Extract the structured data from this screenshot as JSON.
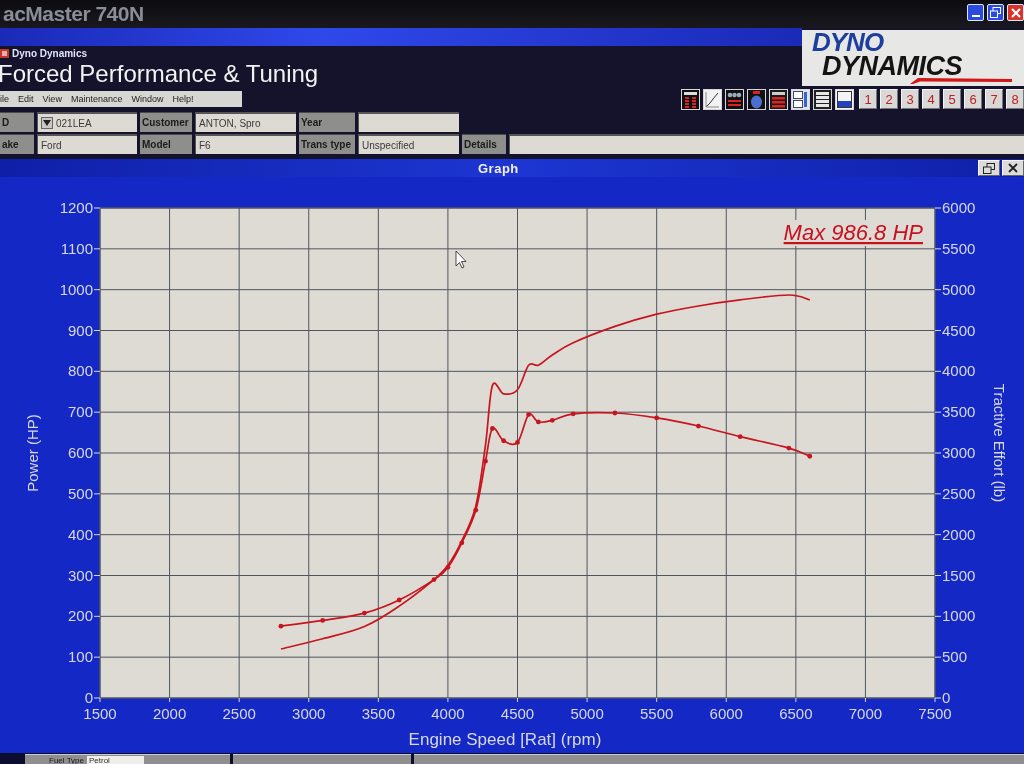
{
  "monitor": {
    "model_label": "acMaster 740N"
  },
  "window": {
    "title": "Dyno Dynamics"
  },
  "header": {
    "title": "Forced Performance & Tuning",
    "logo": {
      "line_1": "DYNO",
      "line_2": "DYNAMICS"
    }
  },
  "menu": {
    "items": [
      "ile",
      "Edit",
      "View",
      "Maintenance",
      "Window",
      "Help!"
    ]
  },
  "toolbar": {
    "run_buttons": [
      "1",
      "2",
      "3",
      "4",
      "5",
      "6",
      "7",
      "8"
    ]
  },
  "vehicle_form": {
    "rows": [
      {
        "fields": [
          {
            "kind": "dropdown",
            "label": "D",
            "value": "021LEA"
          },
          {
            "kind": "text",
            "label": "Customer",
            "value": "ANTON, Spro"
          },
          {
            "kind": "text",
            "label": "Year"
          }
        ]
      },
      {
        "fields": [
          {
            "kind": "text",
            "label": "ake",
            "value": "Ford"
          },
          {
            "kind": "text",
            "label": "Model",
            "value": "F6"
          },
          {
            "kind": "text",
            "label": "Trans type",
            "value": "Unspecified"
          },
          {
            "kind": "wide",
            "label": "Details"
          }
        ]
      }
    ]
  },
  "graph_window": {
    "title": "Graph",
    "chart_data": {
      "type": "line",
      "xlabel": "Engine Speed [Rat] (rpm)",
      "ylabel": "Power (HP)",
      "y2label": "Tractive Effort (lb)",
      "grid": true,
      "x": [
        2800,
        3100,
        3400,
        3650,
        3900,
        4000,
        4100,
        4200,
        4270,
        4320,
        4400,
        4500,
        4580,
        4650,
        4750,
        4900,
        5200,
        5500,
        5800,
        6100,
        6450,
        6600
      ],
      "series": [
        {
          "color": "#c8141e",
          "values": [
            120,
            145,
            175,
            225,
            290,
            325,
            385,
            470,
            620,
            765,
            745,
            755,
            815,
            815,
            840,
            870,
            910,
            940,
            960,
            975,
            987,
            975
          ]
        },
        {
          "axis": "y2",
          "color": "#c8141e",
          "values": [
            880,
            950,
            1040,
            1200,
            1450,
            1600,
            1900,
            2300,
            2900,
            3300,
            3150,
            3130,
            3470,
            3380,
            3400,
            3480,
            3490,
            3430,
            3330,
            3200,
            3060,
            2960
          ]
        }
      ],
      "xlim": [
        1500,
        7500
      ],
      "ylim": [
        0,
        1200
      ],
      "y2lim": [
        0,
        6000
      ],
      "xticks": [
        1500,
        2000,
        2500,
        3000,
        3500,
        4000,
        4500,
        5000,
        5500,
        6000,
        6500,
        7000,
        7500
      ],
      "yticks": [
        0,
        100,
        200,
        300,
        400,
        500,
        600,
        700,
        800,
        900,
        1000,
        1100,
        1200
      ],
      "y2ticks": [
        0,
        500,
        1000,
        1500,
        2000,
        2500,
        3000,
        3500,
        4000,
        4500,
        5000,
        5500,
        6000
      ],
      "annotations": [
        {
          "text": "Max 986.8 HP"
        }
      ]
    }
  },
  "status_bar": {
    "fields": [
      {
        "label": "Fuel Type",
        "value": "Petrol"
      }
    ]
  }
}
